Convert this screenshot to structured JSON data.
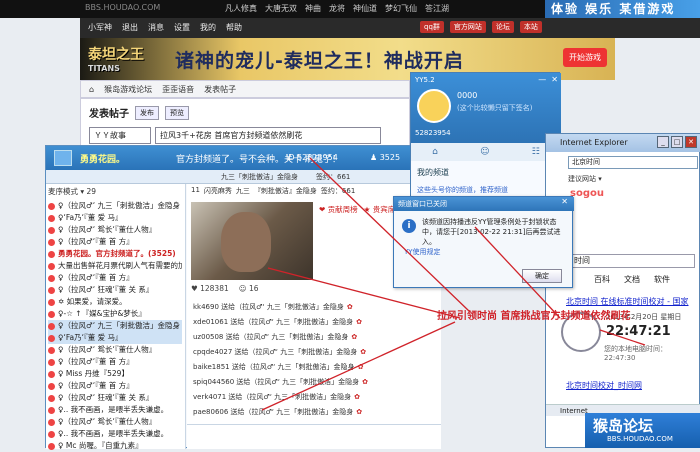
{
  "topnav": {
    "site": "BBS.HOUDAO.COM",
    "links": [
      "凡人修真",
      "大唐无双",
      "神曲",
      "龙将",
      "神仙道",
      "梦幻飞仙",
      "答江湖"
    ],
    "promo": "体验 娱乐 某借游戏"
  },
  "subnav": {
    "left": [
      "小军神",
      "退出",
      "消息",
      "设置",
      "我的",
      "帮助"
    ],
    "right": [
      "qq群",
      "官方网站",
      "论坛",
      "本站"
    ]
  },
  "banner": {
    "logo": "泰坦之王",
    "logo_sub": "TITANS",
    "slogan": "诸神的宠儿-泰坦之王！神战开启",
    "cta": "开始游戏"
  },
  "breadcrumb": [
    "猴岛游戏论坛",
    "歪歪语音",
    "发表帖子"
  ],
  "post": {
    "heading": "发表帖子",
    "btn_publish": "发布",
    "btn_preview": "预览",
    "category": "ＹＹ故事",
    "title": "拉风3千+花房 首席官方封频道依然刷花"
  },
  "yy": {
    "channel_name": "勇勇花园。",
    "notice": "官方封频道了。号不会种。关卡  刷鬼了！",
    "id_text": "ID 52823954",
    "users": "3525",
    "sub_a": "九三「刺批傲洁」金隐身",
    "sub_b": "签约：661",
    "order": "麦序模式 ▾ 29",
    "list": [
      {
        "t": "♀（拉风♂‘ 九三「刺批傲洁」金隐身",
        "hdr": false,
        "sel": false
      },
      {
        "t": "♀‘Fa乃‘『董 爱 马』",
        "hdr": false,
        "sel": false
      },
      {
        "t": "♀（拉风♂‘ 鸳长‘『董仕人物』",
        "hdr": false,
        "sel": false
      },
      {
        "t": "♀（拉风♂‘『董 首 方』",
        "hdr": false,
        "sel": false
      },
      {
        "t": "勇勇花园。官方封频道了。(3525)",
        "hdr": true,
        "sel": false
      },
      {
        "t": "大量出售鲜花月票代刷人气有需要的加",
        "hdr": false,
        "sel": false
      },
      {
        "t": "♀（拉风♂‘『董 首 方』",
        "hdr": false,
        "sel": false
      },
      {
        "t": "♀（拉风♂‘ 狂魂‘『董 关 系』",
        "hdr": false,
        "sel": false
      },
      {
        "t": "✡ 如果爱，请深爱。",
        "hdr": false,
        "sel": false
      },
      {
        "t": "♀-☆ ↑『媒&宝护&梦长』",
        "hdr": false,
        "sel": false
      },
      {
        "t": "♀（拉风♂‘ 九三「刺批傲洁」金隐身",
        "hdr": false,
        "sel": true
      },
      {
        "t": "♀‘Fa乃‘『董 爱 马』",
        "hdr": false,
        "sel": true
      },
      {
        "t": "♀（拉风♂‘ 鸳长‘『董仕人物』",
        "hdr": false,
        "sel": false
      },
      {
        "t": "♀（拉风♂‘『董 首 方』",
        "hdr": false,
        "sel": false
      },
      {
        "t": "♀ Miss 丹维『529】",
        "hdr": false,
        "sel": false
      },
      {
        "t": "♀（拉风♂‘『董 首 方』",
        "hdr": false,
        "sel": false
      },
      {
        "t": "♀（拉风♂‘ 狂魂‘『董 关 系』",
        "hdr": false,
        "sel": false
      },
      {
        "t": "♀.. 我不画画，是喂半丢失谦虚。",
        "hdr": false,
        "sel": false
      },
      {
        "t": "♀（拉风♂‘ 鸳长‘『董仕人物』",
        "hdr": false,
        "sel": false
      },
      {
        "t": "♀.. 我不画画，是喂半丢失谦虚。",
        "hdr": false,
        "sel": false
      },
      {
        "t": "♀ Mc 尚喔。『自重九素』",
        "hdr": false,
        "sel": false
      }
    ],
    "mid_tabs": [
      "11",
      "闪亮麻秀",
      "九三",
      "『刺批傲洁』金隐身",
      "签约：661"
    ],
    "gifts": [
      "贡献周榜",
      "贵宾席"
    ],
    "mic": [
      "128381",
      "16"
    ],
    "chat": [
      "kk4690 送给（拉风♂‘ 九三「刺批傲洁」金隐身",
      "xde01061 送给（拉风♂‘ 九三「刺批傲洁」金隐身",
      "uz00508 送给（拉风♂‘ 九三「刺批傲洁」金隐身",
      "cpqde4027 送给（拉风♂‘ 九三「刺批傲洁」金隐身",
      "baike1851 送给（拉风♂‘ 九三「刺批傲洁」金隐身",
      "spiq044560 送给（拉风♂‘ 九三「刺批傲洁」金隐身",
      "verk4071 送给（拉风♂‘ 九三「刺批傲洁」金隐身",
      "pae80606 送给（拉风♂‘ 九三「刺批傲洁」金隐身"
    ]
  },
  "yy52": {
    "title": "YY5.2",
    "name": "0000",
    "sig": "(这个比较懒只留下签名)",
    "uid": "52823954",
    "my_channels": "我的频道",
    "link": "这些头号你的频道，推荐频道"
  },
  "dialog": {
    "title": "频道窗口已关闭",
    "message": "该频道因持播违反YY管理条例处于封锁状态中，请您于[2013-02-22 21:31]后再尝试进入。",
    "rule": "YY使用规定",
    "ok": "确定"
  },
  "ie": {
    "title": "Internet Explorer",
    "address": "北京时间",
    "fav": "建议网站 ▾",
    "brand": "sogou",
    "query": "时间",
    "cats": [
      "百科",
      "文档",
      "软件"
    ],
    "r1": "北京时间  在线标准时间校对 - 国家",
    "date": "2013年2月20日 星期日",
    "time": "22:47:21",
    "local": "您的本地电脑时间： 22:47:30",
    "r2": "北京时间校对_时间网",
    "status": "Internet"
  },
  "watermark": {
    "big": "猴岛论坛",
    "small": "BBS.HOUDAO.COM"
  },
  "annotation": "拉风引领时尚 首席挑战官方封频道依然刷花"
}
